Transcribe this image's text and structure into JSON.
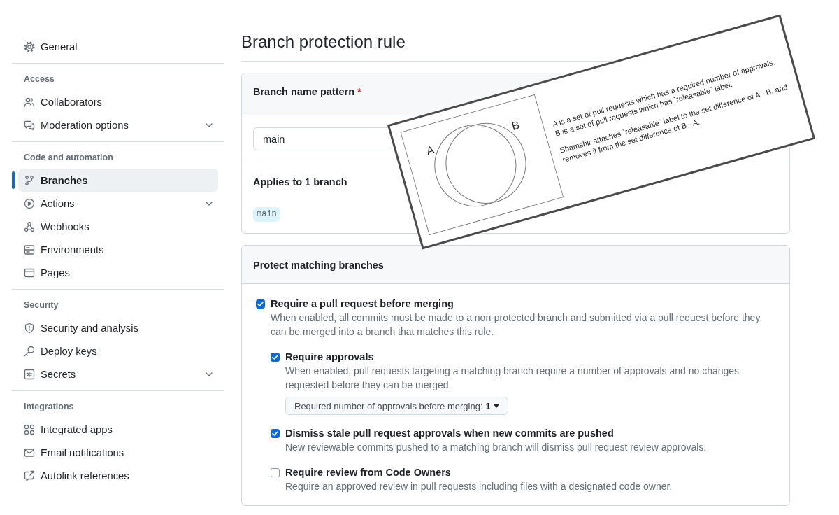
{
  "sidebar": {
    "sections": [
      {
        "items": [
          {
            "label": "General",
            "selected": false,
            "expandable": false
          }
        ]
      },
      {
        "title": "Access",
        "items": [
          {
            "label": "Collaborators",
            "selected": false,
            "expandable": false
          },
          {
            "label": "Moderation options",
            "selected": false,
            "expandable": true
          }
        ]
      },
      {
        "title": "Code and automation",
        "items": [
          {
            "label": "Branches",
            "selected": true,
            "expandable": false
          },
          {
            "label": "Actions",
            "selected": false,
            "expandable": true
          },
          {
            "label": "Webhooks",
            "selected": false,
            "expandable": false
          },
          {
            "label": "Environments",
            "selected": false,
            "expandable": false
          },
          {
            "label": "Pages",
            "selected": false,
            "expandable": false
          }
        ]
      },
      {
        "title": "Security",
        "items": [
          {
            "label": "Security and analysis",
            "selected": false,
            "expandable": false
          },
          {
            "label": "Deploy keys",
            "selected": false,
            "expandable": false
          },
          {
            "label": "Secrets",
            "selected": false,
            "expandable": true
          }
        ]
      },
      {
        "title": "Integrations",
        "items": [
          {
            "label": "Integrated apps",
            "selected": false,
            "expandable": false
          },
          {
            "label": "Email notifications",
            "selected": false,
            "expandable": false
          },
          {
            "label": "Autolink references",
            "selected": false,
            "expandable": false
          }
        ]
      }
    ]
  },
  "page_title": "Branch protection rule",
  "pattern_section": {
    "label": "Branch name pattern",
    "required_mark": "*",
    "value": "main",
    "applies_label": "Applies to 1 branch",
    "matching_branches": [
      "main"
    ]
  },
  "protect_section": {
    "title": "Protect matching branches",
    "rules": [
      {
        "label": "Require a pull request before merging",
        "description": "When enabled, all commits must be made to a non-protected branch and submitted via a pull request before they can be merged into a branch that matches this rule.",
        "checked": true,
        "children": [
          {
            "label": "Require approvals",
            "description": "When enabled, pull requests targeting a matching branch require a number of approvals and no changes requested before they can be merged.",
            "checked": true,
            "dropdown": {
              "label": "Required number of approvals before merging:",
              "value": "1"
            }
          },
          {
            "label": "Dismiss stale pull request approvals when new commits are pushed",
            "description": "New reviewable commits pushed to a matching branch will dismiss pull request review approvals.",
            "checked": true
          },
          {
            "label": "Require review from Code Owners",
            "description": "Require an approved review in pull requests including files with a designated code owner.",
            "checked": false
          }
        ]
      }
    ]
  },
  "overlay_diagram": {
    "set_labels": [
      "A",
      "B"
    ],
    "statements": [
      "A is a set of pull requests which has a required number of approvals.",
      "B is a set of pull requests which has `releasable` label."
    ],
    "note": "Shamshir attaches `releasable` label to the set difference of A - B, and removes it from the set difference of B - A."
  }
}
